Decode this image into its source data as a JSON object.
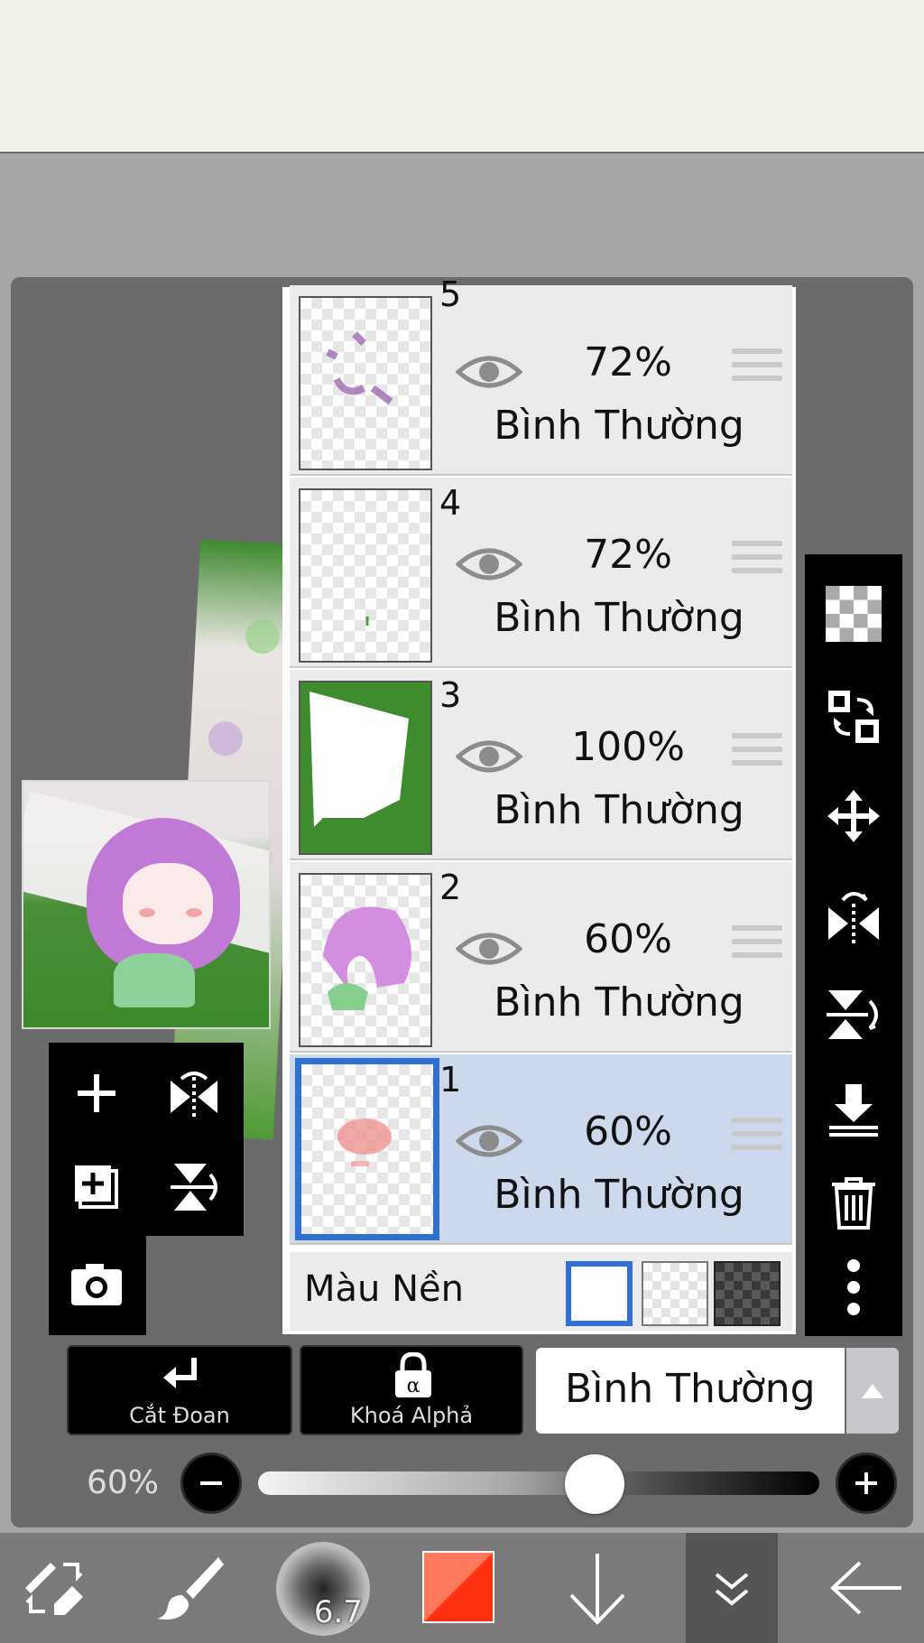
{
  "layers": [
    {
      "number": "5",
      "opacity": "72%",
      "blend": "Bình Thường"
    },
    {
      "number": "4",
      "opacity": "72%",
      "blend": "Bình Thường"
    },
    {
      "number": "3",
      "opacity": "100%",
      "blend": "Bình Thường"
    },
    {
      "number": "2",
      "opacity": "60%",
      "blend": "Bình Thường"
    },
    {
      "number": "1",
      "opacity": "60%",
      "blend": "Bình Thường",
      "selected": true
    }
  ],
  "background": {
    "label": "Màu Nền",
    "options": [
      "white",
      "transparent",
      "dark-checker"
    ],
    "selected": "white"
  },
  "actions": {
    "clipping_label": "Cắt Đoan",
    "alpha_lock_label": "Khoá Alphả",
    "blend_mode": "Bình Thường"
  },
  "opacity": {
    "label": "60%",
    "value": 0.6
  },
  "brush": {
    "size": "6.7"
  },
  "colors": {
    "accent": "#2f6fd6",
    "selected_layer": "#ccd9ec",
    "primary_color": "#ff2f10",
    "secondary_color": "#ff7a5c"
  }
}
